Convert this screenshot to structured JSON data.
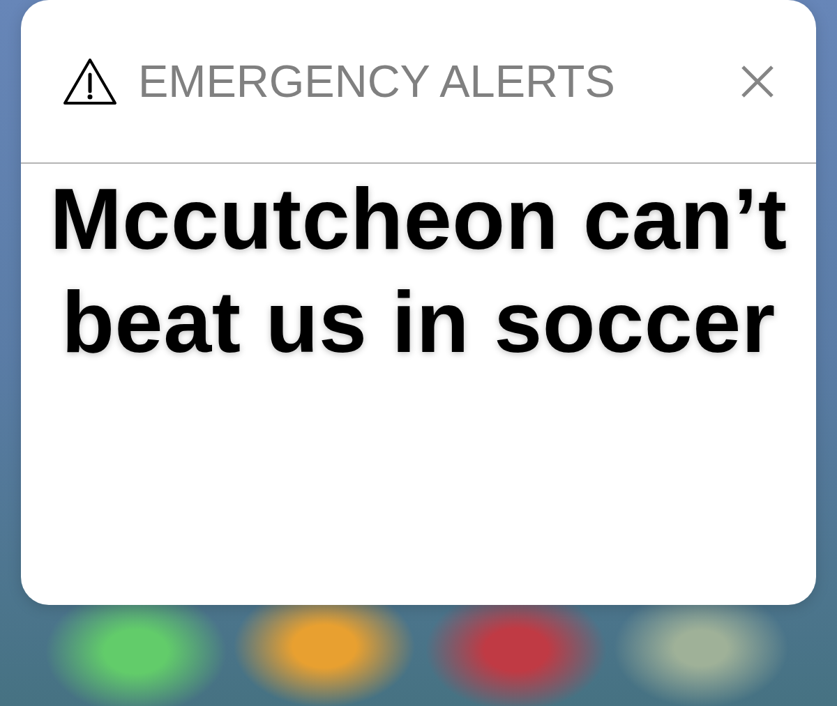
{
  "alert": {
    "header": {
      "title": "EMERGENCY ALERTS"
    },
    "message": "Mccutcheon can’t beat us in soccer"
  }
}
